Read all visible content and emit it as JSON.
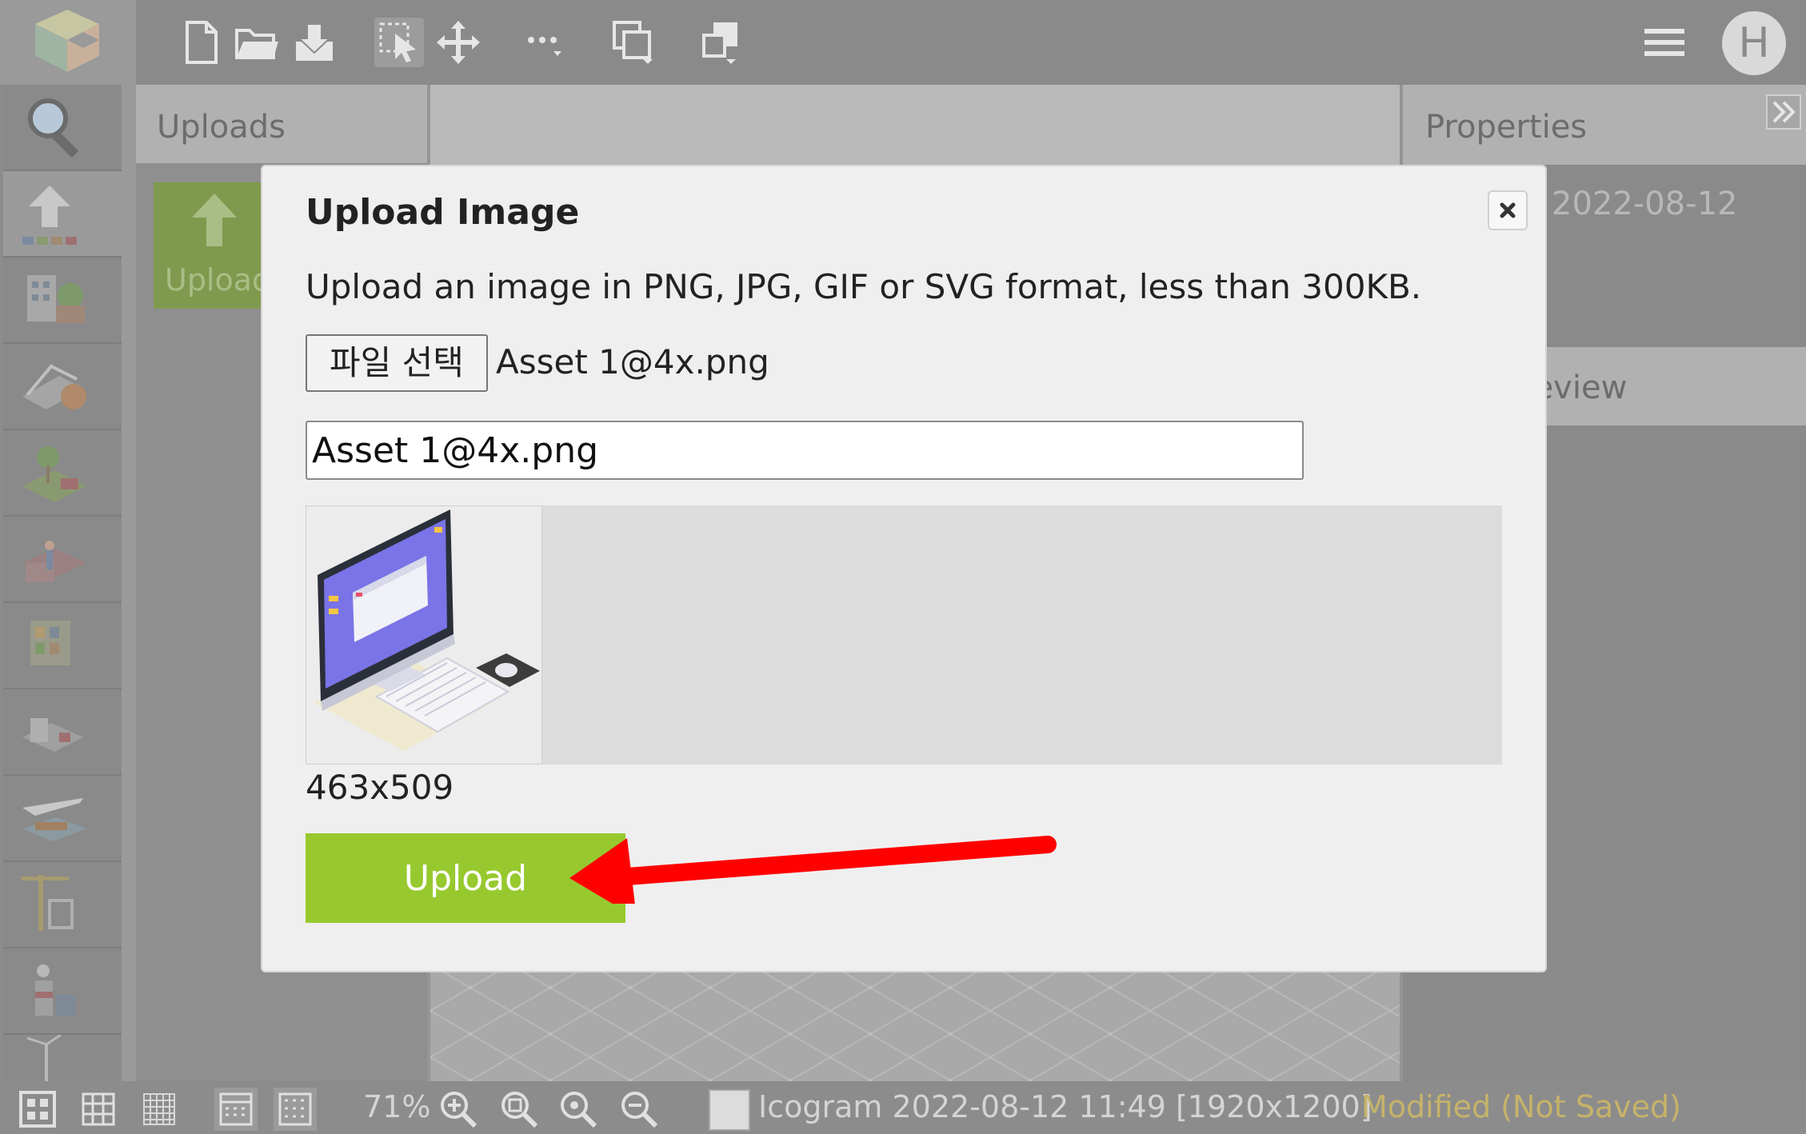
{
  "toolbar": {
    "icons": [
      "logo-icon",
      "new-file-icon",
      "open-folder-icon",
      "save-download-icon",
      "select-icon",
      "move-icon",
      "more-options-icon",
      "duplicate-icon",
      "arrange-icon",
      "menu-icon"
    ],
    "user_initial": "H"
  },
  "left_rail": {
    "items": [
      "search-icon",
      "upload-icon",
      "buildings-icon",
      "sports-icon",
      "nature-icon",
      "people-icon",
      "warehouse-icon",
      "factory-icon",
      "transport-icon",
      "construction-icon",
      "industry-icon",
      "energy-icon"
    ]
  },
  "uploads_panel": {
    "title": "Uploads",
    "tile_label": "Upload"
  },
  "properties_panel": {
    "title": "Properties",
    "date_fragment": "2022-08-12",
    "preview_fragment": "review"
  },
  "modal": {
    "title": "Upload Image",
    "description": "Upload an image in PNG, JPG, GIF or SVG format, less than 300KB.",
    "file_button_label": "파일 선택",
    "file_name": "Asset 1@4x.png",
    "name_field_value": "Asset 1@4x.png",
    "image_dimensions": "463x509",
    "upload_button_label": "Upload"
  },
  "status_bar": {
    "zoom_level": "71%",
    "document_info": "Icogram 2022-08-12 11:49 [1920x1200]",
    "modified_status": "Modified (Not Saved)"
  },
  "colors": {
    "upload_button": "#97c92f",
    "annotation_arrow": "#ff0000",
    "modified_text": "#c6b36a"
  }
}
